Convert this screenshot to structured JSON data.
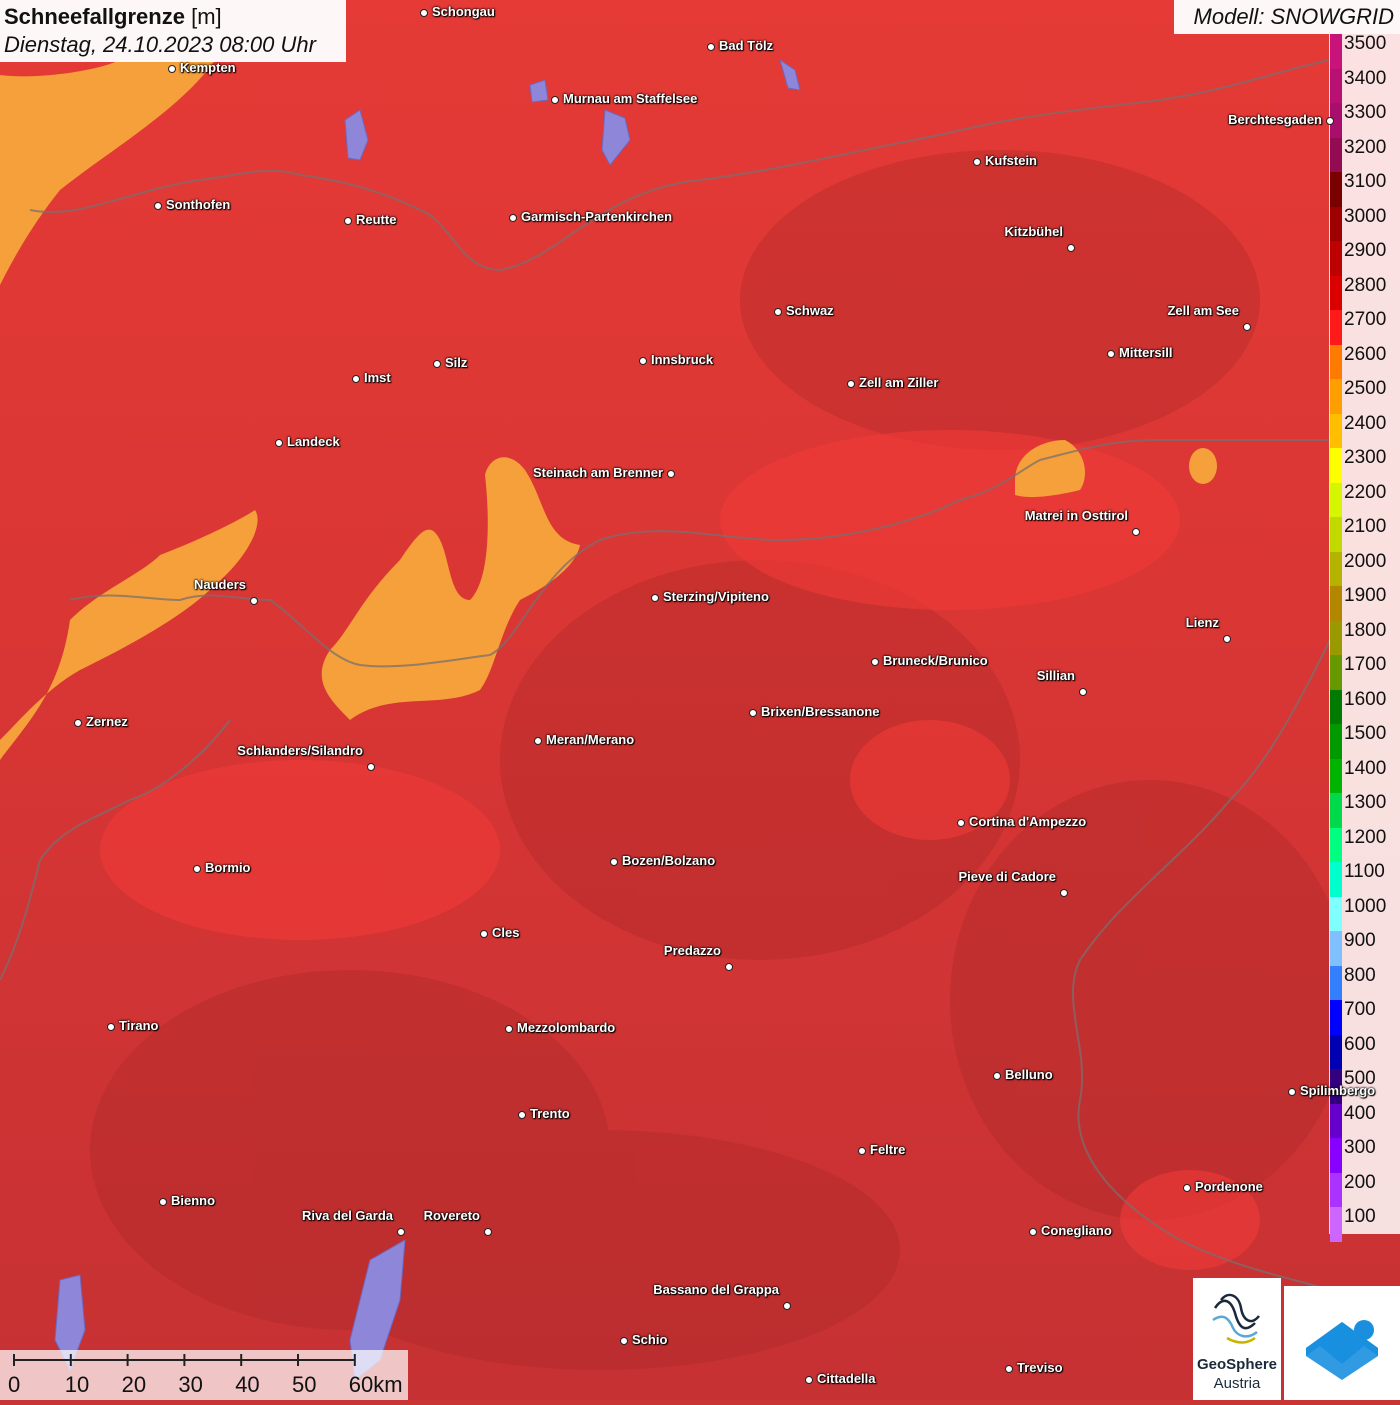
{
  "title": {
    "parameter": "Schneefallgrenze",
    "unit": "[m]",
    "datetime": "Dienstag, 24.10.2023 08:00 Uhr"
  },
  "model_label": "Modell: SNOWGRID",
  "legend": {
    "entries": [
      {
        "value": "3500",
        "color": "#c8137a"
      },
      {
        "value": "3400",
        "color": "#b81173"
      },
      {
        "value": "3300",
        "color": "#a80e6b"
      },
      {
        "value": "3200",
        "color": "#930b52"
      },
      {
        "value": "3100",
        "color": "#7a0000"
      },
      {
        "value": "3000",
        "color": "#9e0000"
      },
      {
        "value": "2900",
        "color": "#bd0000"
      },
      {
        "value": "2800",
        "color": "#db0000"
      },
      {
        "value": "2700",
        "color": "#ff1a1a"
      },
      {
        "value": "2600",
        "color": "#ff7a00"
      },
      {
        "value": "2500",
        "color": "#ff9e00"
      },
      {
        "value": "2400",
        "color": "#ffbf00"
      },
      {
        "value": "2300",
        "color": "#ffff00"
      },
      {
        "value": "2200",
        "color": "#d6f500"
      },
      {
        "value": "2100",
        "color": "#c2d900"
      },
      {
        "value": "2000",
        "color": "#b3b300"
      },
      {
        "value": "1900",
        "color": "#b38600"
      },
      {
        "value": "1800",
        "color": "#999900"
      },
      {
        "value": "1700",
        "color": "#669900"
      },
      {
        "value": "1600",
        "color": "#007a00"
      },
      {
        "value": "1500",
        "color": "#009900"
      },
      {
        "value": "1400",
        "color": "#00b300"
      },
      {
        "value": "1300",
        "color": "#00d94a"
      },
      {
        "value": "1200",
        "color": "#00ff80"
      },
      {
        "value": "1100",
        "color": "#00ffcc"
      },
      {
        "value": "1000",
        "color": "#80ffff"
      },
      {
        "value": "900",
        "color": "#80c0ff"
      },
      {
        "value": "800",
        "color": "#3380ff"
      },
      {
        "value": "700",
        "color": "#0000ff"
      },
      {
        "value": "600",
        "color": "#0000b3"
      },
      {
        "value": "500",
        "color": "#330080"
      },
      {
        "value": "400",
        "color": "#6600cc"
      },
      {
        "value": "300",
        "color": "#8800ff"
      },
      {
        "value": "200",
        "color": "#aa33ff"
      },
      {
        "value": "100",
        "color": "#cc66ff"
      }
    ]
  },
  "scalebar": {
    "labels": [
      "0",
      "10",
      "20",
      "30",
      "40",
      "50",
      "60km"
    ]
  },
  "logos": {
    "geosphere_line1": "GeoSphere",
    "geosphere_line2": "Austria"
  },
  "cities": [
    {
      "name": "Schongau"
    },
    {
      "name": "Kempten"
    },
    {
      "name": "Bad Tölz"
    },
    {
      "name": "Murnau am Staffelsee"
    },
    {
      "name": "Berchtesgaden"
    },
    {
      "name": "Kufstein"
    },
    {
      "name": "Sonthofen"
    },
    {
      "name": "Reutte"
    },
    {
      "name": "Garmisch-Partenkirchen"
    },
    {
      "name": "Kitzbühel"
    },
    {
      "name": "Schwaz"
    },
    {
      "name": "Zell am See"
    },
    {
      "name": "Mittersill"
    },
    {
      "name": "Imst"
    },
    {
      "name": "Silz"
    },
    {
      "name": "Innsbruck"
    },
    {
      "name": "Zell am Ziller"
    },
    {
      "name": "Landeck"
    },
    {
      "name": "Steinach am Brenner"
    },
    {
      "name": "Matrei in Osttirol"
    },
    {
      "name": "Nauders"
    },
    {
      "name": "Sterzing/Vipiteno"
    },
    {
      "name": "Lienz"
    },
    {
      "name": "Bruneck/Brunico"
    },
    {
      "name": "Sillian"
    },
    {
      "name": "Brixen/Bressanone"
    },
    {
      "name": "Zernez"
    },
    {
      "name": "Meran/Merano"
    },
    {
      "name": "Schlanders/Silandro"
    },
    {
      "name": "Cortina d'Ampezzo"
    },
    {
      "name": "Bozen/Bolzano"
    },
    {
      "name": "Bormio"
    },
    {
      "name": "Pieve di Cadore"
    },
    {
      "name": "Cles"
    },
    {
      "name": "Predazzo"
    },
    {
      "name": "Tirano"
    },
    {
      "name": "Mezzolombardo"
    },
    {
      "name": "Belluno"
    },
    {
      "name": "Trento"
    },
    {
      "name": "Feltre"
    },
    {
      "name": "Pordenone"
    },
    {
      "name": "Bienno"
    },
    {
      "name": "Riva del Garda"
    },
    {
      "name": "Rovereto"
    },
    {
      "name": "Conegliano"
    },
    {
      "name": "Bassano del Grappa"
    },
    {
      "name": "Schio"
    },
    {
      "name": "Treviso"
    },
    {
      "name": "Cittadella"
    },
    {
      "name": "Spilimbergo"
    }
  ]
}
